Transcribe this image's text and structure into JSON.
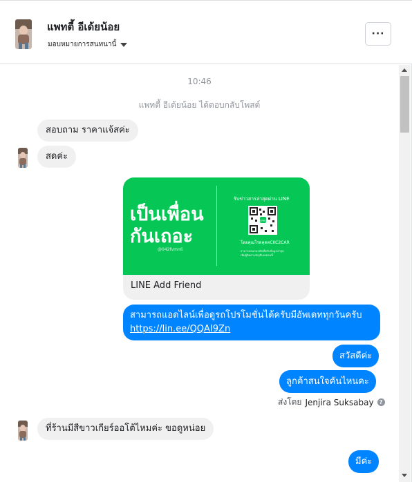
{
  "header": {
    "name": "แพทตี้ อีเด้ยน้อย",
    "subtitle": "มอบหมายการสนทนานี้",
    "more_label": "···"
  },
  "conversation": {
    "time": "10:46",
    "system_message": "แพทตี้ อีเด้ยน้อย ได้ตอบกลับโพสต์",
    "messages": [
      {
        "from": "customer",
        "text": "สอบถาม ราคาแจ้สค่ะ"
      },
      {
        "from": "customer",
        "text": "สดค่ะ"
      },
      {
        "from": "page",
        "type": "card",
        "card": {
          "big_line1": "เป็นเพื่อน",
          "big_line2": "กันเถอะ",
          "handle": "@042fvmn6",
          "right_top": "รับข่าวสารล่าสุดผ่าน LINE",
          "scan_text": "โดยคุณโรดคุดตCKC2CAR",
          "small1": "สามารถสแกนรหัสเพื่อรับข้อมูลล่าสุด",
          "small2": "เพิ่มผู้ติดตามบัญชีเลยตอนนี้",
          "title": "LINE Add Friend"
        }
      },
      {
        "from": "page",
        "text": "สามารถแอดไลน์เพื่อดูรถโปรโมชั่นได้ครับมีอัพเดททุกวันครับ",
        "link": "https://lin.ee/QQAI9Zn"
      },
      {
        "from": "page",
        "text": "สวัสดีค่ะ"
      },
      {
        "from": "page",
        "text": "ลูกค้าสนใจคันไหนคะ"
      },
      {
        "from": "customer",
        "text": "ที่ร้านมีสีขาวเกียร์ออโต้ไหมค่ะ ขอดูหน่อย"
      },
      {
        "from": "page",
        "text": "มีค่ะ"
      }
    ],
    "sent_by_prefix": "ส่งโดย",
    "sent_by_name": "Jenjira Suksabay",
    "info_icon": "?"
  },
  "colors": {
    "outgoing_bubble": "#0084ff",
    "incoming_bubble": "#f1f0f0",
    "line_green": "#06c755"
  }
}
